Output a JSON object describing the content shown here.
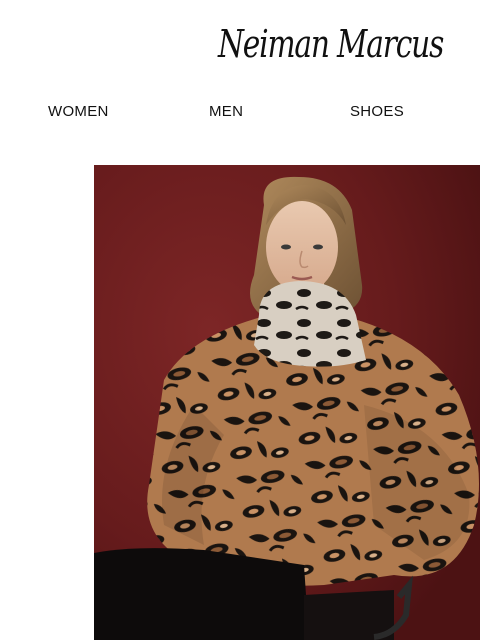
{
  "brand": {
    "logo_text": "Neiman Marcus"
  },
  "nav": {
    "items": [
      {
        "label": "WOMEN"
      },
      {
        "label": "MEN"
      },
      {
        "label": "SHOES"
      }
    ]
  },
  "hero": {
    "background_color": "#6e1f1f",
    "subject": "model-in-leopard-print-faux-fur-jacket"
  }
}
